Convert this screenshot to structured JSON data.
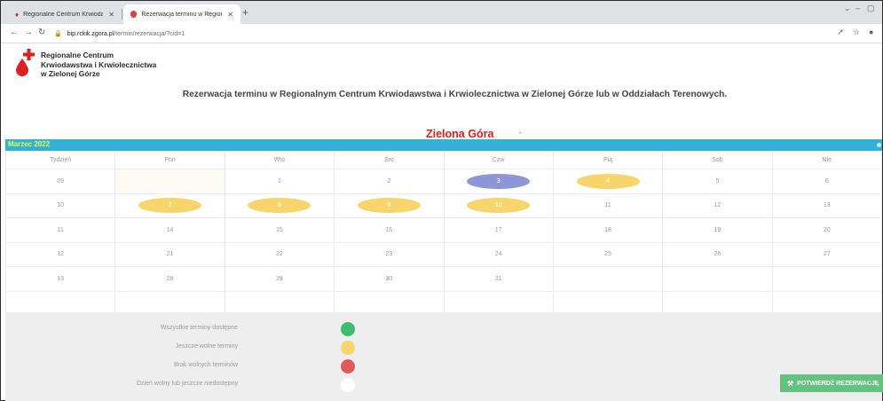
{
  "browser": {
    "tabs": [
      {
        "title": "Regionalne Centrum Krwiodawst",
        "close": "✕"
      },
      {
        "title": "Rezerwacja terminu w Regional",
        "close": "✕"
      }
    ],
    "new_tab": "+",
    "url_host": "bip.rckik.zgora.pl",
    "url_path": "/termin/rezerwacja/?cid=1"
  },
  "header": {
    "logo_lines": [
      "Regionalne Centrum",
      "Krwiodawstwa i Krwiolecznictwa",
      "w Zielonej Górze"
    ],
    "headline": "Rezerwacja terminu w Regionalnym Centrum Krwiodawstwa i Krwiolecznictwa w Zielonej Górze lub w Oddziałach Terenowych.",
    "city": "Zielona Góra",
    "city_caret": "-"
  },
  "calendar": {
    "month": "Marzec 2022",
    "columns": [
      "Tydzień",
      "Pon",
      "Wto",
      "Śro",
      "Czw",
      "Pią",
      "Sob",
      "Nie"
    ],
    "rows": [
      {
        "week": "09",
        "days": [
          {
            "d": "",
            "s": "blank-first"
          },
          {
            "d": "1"
          },
          {
            "d": "2"
          },
          {
            "d": "3",
            "s": "blue"
          },
          {
            "d": "4",
            "s": "yellow"
          },
          {
            "d": "5"
          },
          {
            "d": "6"
          }
        ]
      },
      {
        "week": "10",
        "days": [
          {
            "d": "7",
            "s": "yellow"
          },
          {
            "d": "8",
            "s": "yellow"
          },
          {
            "d": "9",
            "s": "yellow"
          },
          {
            "d": "10",
            "s": "yellow"
          },
          {
            "d": "11"
          },
          {
            "d": "12"
          },
          {
            "d": "13"
          }
        ]
      },
      {
        "week": "11",
        "days": [
          {
            "d": "14"
          },
          {
            "d": "15"
          },
          {
            "d": "16"
          },
          {
            "d": "17"
          },
          {
            "d": "18"
          },
          {
            "d": "19"
          },
          {
            "d": "20"
          }
        ]
      },
      {
        "week": "12",
        "days": [
          {
            "d": "21"
          },
          {
            "d": "22"
          },
          {
            "d": "23"
          },
          {
            "d": "24"
          },
          {
            "d": "25"
          },
          {
            "d": "26"
          },
          {
            "d": "27"
          }
        ]
      },
      {
        "week": "13",
        "days": [
          {
            "d": "28"
          },
          {
            "d": "29"
          },
          {
            "d": "30"
          },
          {
            "d": "31"
          },
          {
            "d": ""
          },
          {
            "d": ""
          },
          {
            "d": ""
          }
        ]
      },
      {
        "week": "",
        "days": [
          {
            "d": ""
          },
          {
            "d": ""
          },
          {
            "d": ""
          },
          {
            "d": ""
          },
          {
            "d": ""
          },
          {
            "d": ""
          },
          {
            "d": ""
          }
        ]
      }
    ]
  },
  "legend": [
    {
      "label": "Wszystkie terminy dostępne",
      "color": "#3dbd6e"
    },
    {
      "label": "Jeszcze wolne terminy",
      "color": "#f8d56a"
    },
    {
      "label": "Brak wolnych terminów",
      "color": "#e05a5a"
    },
    {
      "label": "Dzień wolny lub jeszcze niedostępny",
      "color": "#ffffff"
    }
  ],
  "confirm_label": "POTWIERDŹ REZERWACJĘ",
  "colors": {
    "accent": "#33b2d9",
    "month_text": "#e7ff3b",
    "city": "#e21b1b",
    "confirm": "#63c27d"
  }
}
